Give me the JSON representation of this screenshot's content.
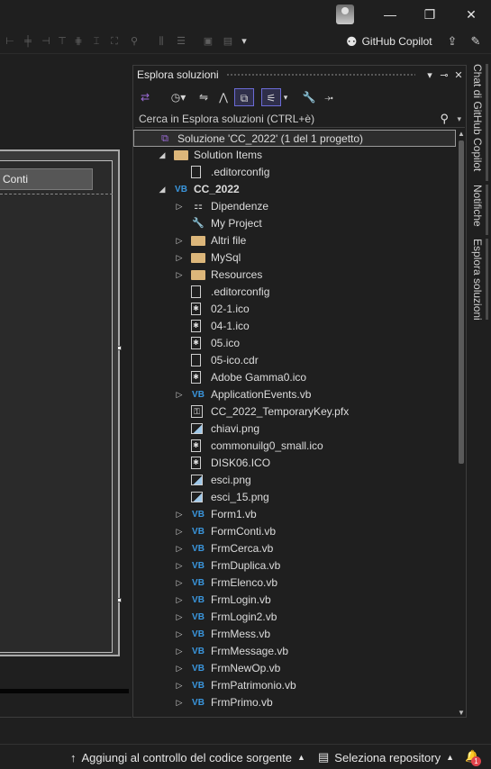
{
  "window": {
    "minimize_glyph": "—",
    "restore_glyph": "❐",
    "close_glyph": "✕"
  },
  "toolbar": {
    "copilot_label": "GitHub Copilot"
  },
  "designer": {
    "tab_label": "Conti"
  },
  "solution_explorer": {
    "title": "Esplora soluzioni",
    "search_placeholder": "Cerca in Esplora soluzioni (CTRL+è)",
    "items": [
      {
        "label": "Soluzione 'CC_2022' (1 del 1 progetto)",
        "icon": "solution-icon",
        "indent": 0,
        "expander": "",
        "selected": true
      },
      {
        "label": "Solution Items",
        "icon": "folder-icon",
        "indent": 1,
        "expander": "expanded"
      },
      {
        "label": ".editorconfig",
        "icon": "file-icon",
        "indent": 2,
        "expander": ""
      },
      {
        "label": "CC_2022",
        "icon": "vb-project-icon",
        "indent": 1,
        "expander": "expanded",
        "bold": true
      },
      {
        "label": "Dipendenze",
        "icon": "dependencies-icon",
        "indent": 2,
        "expander": "collapsed"
      },
      {
        "label": "My Project",
        "icon": "my-project-icon",
        "indent": 2,
        "expander": ""
      },
      {
        "label": "Altri file",
        "icon": "folder-icon",
        "indent": 2,
        "expander": "collapsed"
      },
      {
        "label": "MySql",
        "icon": "folder-icon",
        "indent": 2,
        "expander": "collapsed"
      },
      {
        "label": "Resources",
        "icon": "folder-icon",
        "indent": 2,
        "expander": "collapsed"
      },
      {
        "label": ".editorconfig",
        "icon": "file-icon",
        "indent": 2,
        "expander": ""
      },
      {
        "label": "02-1.ico",
        "icon": "ico-file-icon",
        "indent": 2,
        "expander": ""
      },
      {
        "label": "04-1.ico",
        "icon": "ico-file-icon",
        "indent": 2,
        "expander": ""
      },
      {
        "label": "05.ico",
        "icon": "ico-file-icon",
        "indent": 2,
        "expander": ""
      },
      {
        "label": "05-ico.cdr",
        "icon": "file-icon",
        "indent": 2,
        "expander": ""
      },
      {
        "label": "Adobe Gamma0.ico",
        "icon": "ico-file-icon",
        "indent": 2,
        "expander": ""
      },
      {
        "label": "ApplicationEvents.vb",
        "icon": "vb-file-icon",
        "indent": 2,
        "expander": "collapsed"
      },
      {
        "label": "CC_2022_TemporaryKey.pfx",
        "icon": "key-file-icon",
        "indent": 2,
        "expander": ""
      },
      {
        "label": "chiavi.png",
        "icon": "image-file-icon",
        "indent": 2,
        "expander": ""
      },
      {
        "label": "commonuilg0_small.ico",
        "icon": "ico-file-icon",
        "indent": 2,
        "expander": ""
      },
      {
        "label": "DISK06.ICO",
        "icon": "ico-file-icon",
        "indent": 2,
        "expander": ""
      },
      {
        "label": "esci.png",
        "icon": "image-file-icon",
        "indent": 2,
        "expander": ""
      },
      {
        "label": "esci_15.png",
        "icon": "image-file-icon",
        "indent": 2,
        "expander": ""
      },
      {
        "label": "Form1.vb",
        "icon": "vb-file-icon",
        "indent": 2,
        "expander": "collapsed"
      },
      {
        "label": "FormConti.vb",
        "icon": "vb-file-icon",
        "indent": 2,
        "expander": "collapsed"
      },
      {
        "label": "FrmCerca.vb",
        "icon": "vb-file-icon",
        "indent": 2,
        "expander": "collapsed"
      },
      {
        "label": "FrmDuplica.vb",
        "icon": "vb-file-icon",
        "indent": 2,
        "expander": "collapsed"
      },
      {
        "label": "FrmElenco.vb",
        "icon": "vb-file-icon",
        "indent": 2,
        "expander": "collapsed"
      },
      {
        "label": "FrmLogin.vb",
        "icon": "vb-file-icon",
        "indent": 2,
        "expander": "collapsed"
      },
      {
        "label": "FrmLogin2.vb",
        "icon": "vb-file-icon",
        "indent": 2,
        "expander": "collapsed"
      },
      {
        "label": "FrmMess.vb",
        "icon": "vb-file-icon",
        "indent": 2,
        "expander": "collapsed"
      },
      {
        "label": "FrmMessage.vb",
        "icon": "vb-file-icon",
        "indent": 2,
        "expander": "collapsed"
      },
      {
        "label": "FrmNewOp.vb",
        "icon": "vb-file-icon",
        "indent": 2,
        "expander": "collapsed"
      },
      {
        "label": "FrmPatrimonio.vb",
        "icon": "vb-file-icon",
        "indent": 2,
        "expander": "collapsed"
      },
      {
        "label": "FrmPrimo.vb",
        "icon": "vb-file-icon",
        "indent": 2,
        "expander": "collapsed"
      }
    ]
  },
  "side_tabs": [
    "Chat di GitHub Copilot",
    "Notifiche",
    "Esplora soluzioni"
  ],
  "statusbar": {
    "source_control_label": "Aggiungi al controllo del codice sorgente",
    "repository_label": "Seleziona repository",
    "notification_count": "1"
  },
  "colors": {
    "background": "#1f1f1f",
    "vb_blue": "#3a96dd",
    "folder": "#dcb67a",
    "accent_purple": "#6b6bd6",
    "badge_red": "#e0434b"
  }
}
